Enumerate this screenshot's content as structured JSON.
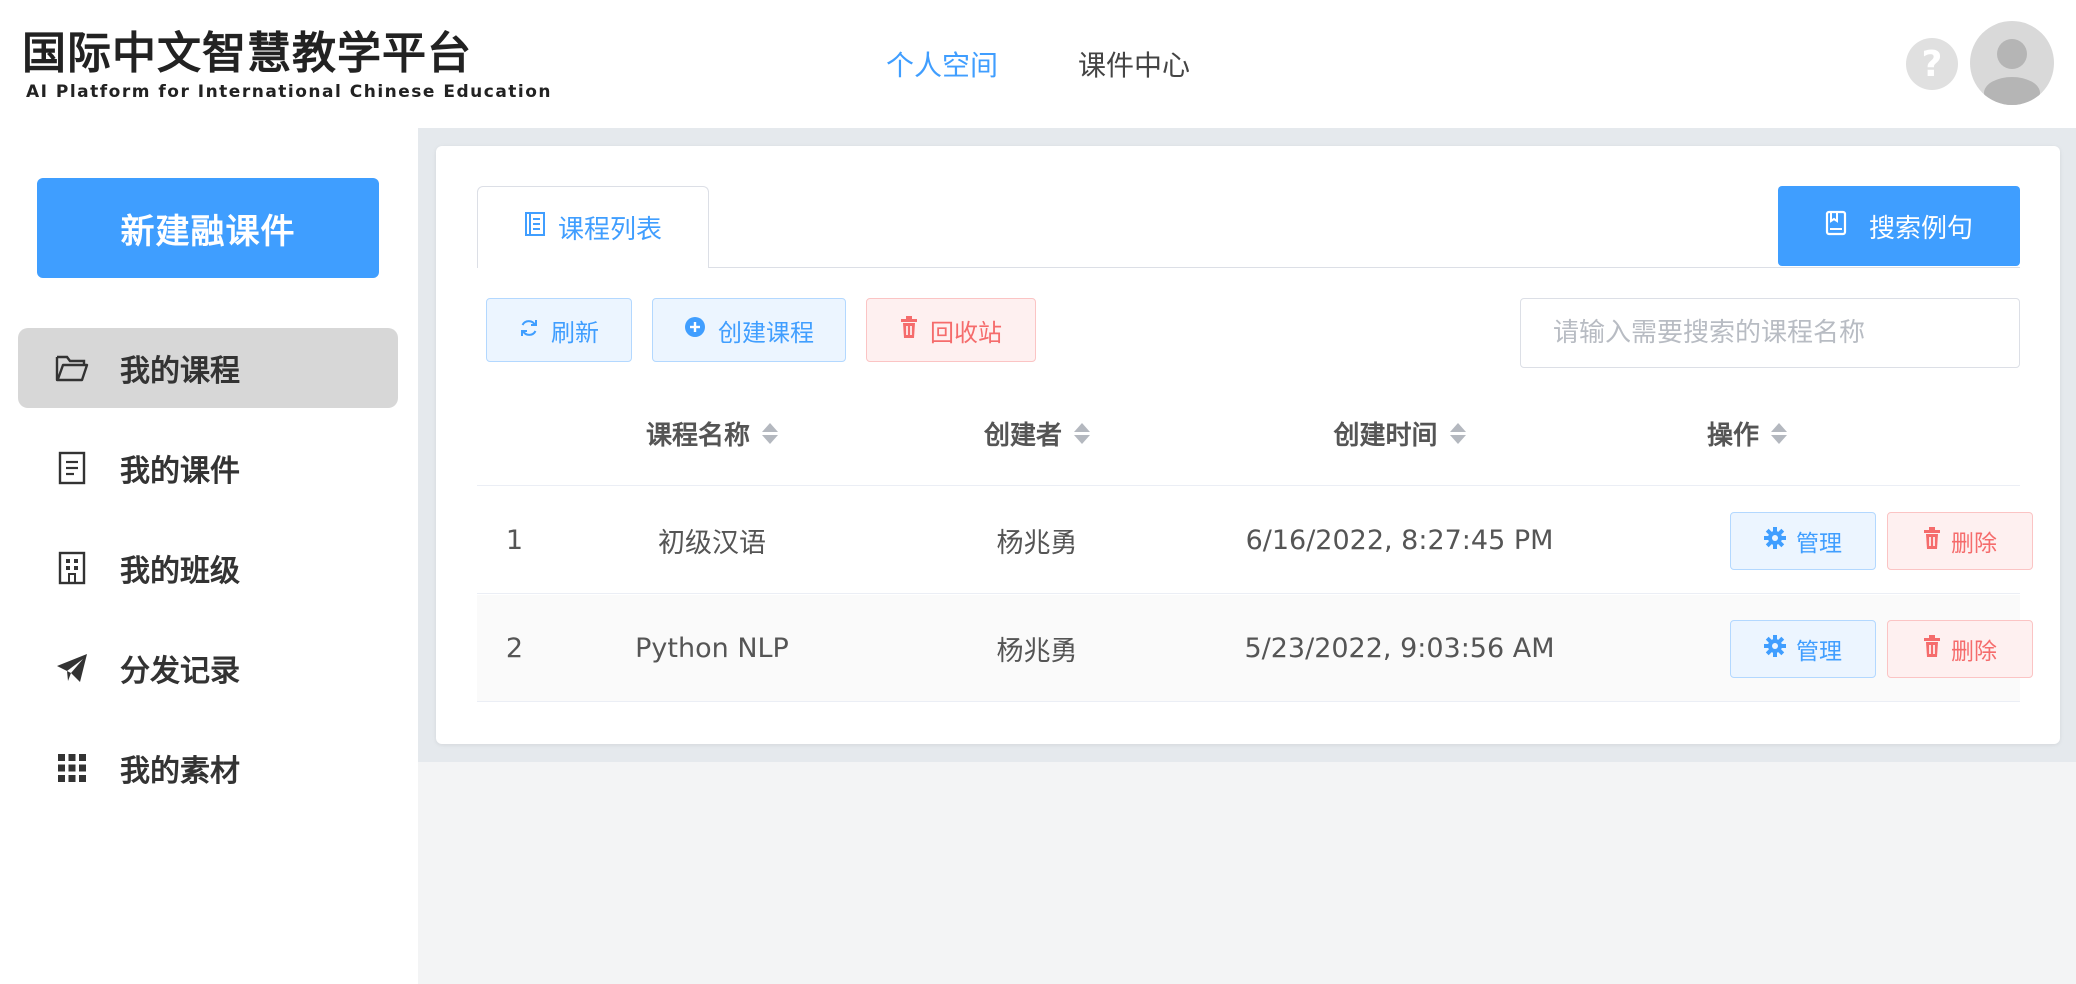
{
  "header": {
    "logo_cn": "国际中文智慧教学平台",
    "logo_en": "AI Platform for International Chinese Education",
    "nav": [
      "个人空间",
      "课件中心"
    ],
    "active_nav": 0,
    "help_glyph": "?"
  },
  "sidebar": {
    "new_button": "新建融课件",
    "items": [
      {
        "label": "我的课程",
        "icon": "folder-open-icon",
        "active": true
      },
      {
        "label": "我的课件",
        "icon": "document-icon",
        "active": false
      },
      {
        "label": "我的班级",
        "icon": "building-icon",
        "active": false
      },
      {
        "label": "分发记录",
        "icon": "paper-plane-icon",
        "active": false
      },
      {
        "label": "我的素材",
        "icon": "grid-icon",
        "active": false
      }
    ]
  },
  "main": {
    "tab_label": "课程列表",
    "search_example_label": "搜索例句",
    "toolbar": {
      "refresh": "刷新",
      "create": "创建课程",
      "recycle": "回收站"
    },
    "search": {
      "placeholder": "请输入需要搜索的课程名称",
      "value": ""
    },
    "table": {
      "columns": [
        "课程名称",
        "创建者",
        "创建时间",
        "操作"
      ],
      "rows": [
        {
          "index": "1",
          "name": "初级汉语",
          "creator": "杨兆勇",
          "created": "6/16/2022, 8:27:45 PM"
        },
        {
          "index": "2",
          "name": "Python NLP",
          "creator": "杨兆勇",
          "created": "5/23/2022, 9:03:56 AM"
        }
      ],
      "manage_label": "管理",
      "delete_label": "删除"
    }
  },
  "colors": {
    "primary": "#409eff",
    "danger": "#f56c6c",
    "sidebar_active": "#d7d7d7"
  }
}
